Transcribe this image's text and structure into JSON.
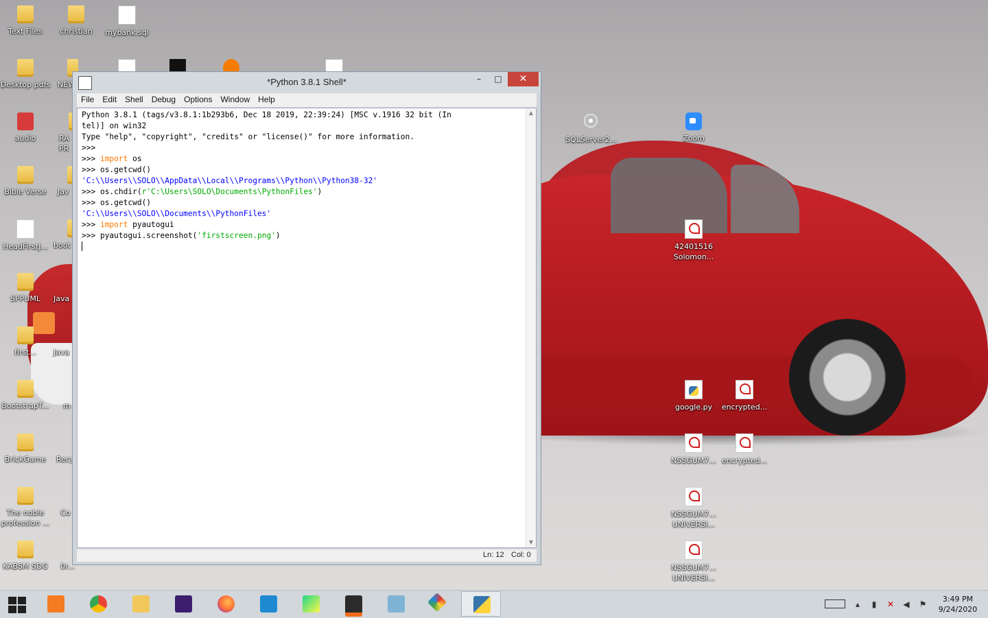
{
  "desktop": {
    "icons": [
      {
        "label": "Text Files"
      },
      {
        "label": "christian"
      },
      {
        "label": "mybank.sql"
      },
      {
        "label": "Desktop pdfs"
      },
      {
        "label": "NEW"
      },
      {
        "label": "audio"
      },
      {
        "label": "RA PR"
      },
      {
        "label": "Bible Verse"
      },
      {
        "label": "Jav"
      },
      {
        "label": "HeadFirstJ..."
      },
      {
        "label": "boot"
      },
      {
        "label": "SPPUML"
      },
      {
        "label": "Java"
      },
      {
        "label": "first..."
      },
      {
        "label": "Java"
      },
      {
        "label": "BootstrapT..."
      },
      {
        "label": "m"
      },
      {
        "label": "BrickGame"
      },
      {
        "label": "Recy"
      },
      {
        "label": "The noble profession ..."
      },
      {
        "label": "Co"
      },
      {
        "label": "KABSM SDG"
      },
      {
        "label": "0r..."
      },
      {
        "label": "SQLServer2..."
      },
      {
        "label": "Zoom"
      },
      {
        "label": "42401516 Solomon..."
      },
      {
        "label": "google.py"
      },
      {
        "label": "encrypted..."
      },
      {
        "label": "NSSGUM7..."
      },
      {
        "label": "encrypted..."
      },
      {
        "label": "NSSGUM7... UNIVERSI..."
      },
      {
        "label": "NSSGUM7... UNIVERSI..."
      }
    ]
  },
  "shell": {
    "title": "*Python 3.8.1 Shell*",
    "controls": {
      "minimize": "–",
      "maximize": "□",
      "close": "✕"
    },
    "menu": [
      "File",
      "Edit",
      "Shell",
      "Debug",
      "Options",
      "Window",
      "Help"
    ],
    "lines": [
      {
        "parts": [
          {
            "t": "Python 3.8.1 (tags/v3.8.1:1b293b6, Dec 18 2019, 22:39:24) [MSC v.1916 32 bit (In",
            "c": ""
          }
        ]
      },
      {
        "parts": [
          {
            "t": "tel)] on win32",
            "c": ""
          }
        ]
      },
      {
        "parts": [
          {
            "t": "Type \"help\", \"copyright\", \"credits\" or \"license()\" for more information.",
            "c": ""
          }
        ]
      },
      {
        "parts": [
          {
            "t": ">>> ",
            "c": ""
          }
        ]
      },
      {
        "parts": [
          {
            "t": ">>> ",
            "c": ""
          },
          {
            "t": "import",
            "c": "kw"
          },
          {
            "t": " os",
            "c": ""
          }
        ]
      },
      {
        "parts": [
          {
            "t": ">>> ",
            "c": ""
          },
          {
            "t": "os.getcwd()",
            "c": ""
          }
        ]
      },
      {
        "parts": [
          {
            "t": "'C:\\\\Users\\\\SOLO\\\\AppData\\\\Local\\\\Programs\\\\Python\\\\Python38-32'",
            "c": "out"
          }
        ]
      },
      {
        "parts": [
          {
            "t": ">>> ",
            "c": ""
          },
          {
            "t": "os.chdir(",
            "c": ""
          },
          {
            "t": "r'C:\\Users\\SOLO\\Documents\\PythonFiles'",
            "c": "str"
          },
          {
            "t": ")",
            "c": ""
          }
        ]
      },
      {
        "parts": [
          {
            "t": ">>> ",
            "c": ""
          },
          {
            "t": "os.getcwd()",
            "c": ""
          }
        ]
      },
      {
        "parts": [
          {
            "t": "'C:\\\\Users\\\\SOLO\\\\Documents\\\\PythonFiles'",
            "c": "out"
          }
        ]
      },
      {
        "parts": [
          {
            "t": ">>> ",
            "c": ""
          },
          {
            "t": "import",
            "c": "kw"
          },
          {
            "t": " pyautogui",
            "c": ""
          }
        ]
      },
      {
        "parts": [
          {
            "t": ">>> ",
            "c": ""
          },
          {
            "t": "pyautogui.screenshot(",
            "c": ""
          },
          {
            "t": "'firstscreen.png'",
            "c": "str"
          },
          {
            "t": ")",
            "c": ""
          }
        ]
      }
    ],
    "status": {
      "ln": "Ln: 12",
      "col": "Col: 0"
    }
  },
  "taskbar": {
    "apps": [
      {
        "name": "start-button",
        "icon": "windows-logo-icon",
        "color": "#1a1a1a"
      },
      {
        "name": "xampp",
        "icon": "xampp-icon",
        "color": "#f57c20"
      },
      {
        "name": "chrome",
        "icon": "chrome-icon",
        "color": "#34a853"
      },
      {
        "name": "file-explorer",
        "icon": "folder-icon",
        "color": "#f1c75b"
      },
      {
        "name": "texworks",
        "icon": "tex-icon",
        "color": "#3b1f6e"
      },
      {
        "name": "firefox",
        "icon": "firefox-icon",
        "color": "#ff7139"
      },
      {
        "name": "vscode",
        "icon": "vscode-icon",
        "color": "#1f8ad2"
      },
      {
        "name": "pycharm",
        "icon": "pycharm-icon",
        "color": "#111111"
      },
      {
        "name": "sublime",
        "icon": "sublime-icon",
        "color": "#ef6c1a"
      },
      {
        "name": "notepad",
        "icon": "notepad-icon",
        "color": "#7fb3d5"
      },
      {
        "name": "app-colorful",
        "icon": "colorful-app-icon",
        "color": "#e53935"
      },
      {
        "name": "python-idle",
        "icon": "python-idle-icon",
        "color": "#3776ab"
      }
    ],
    "time": "3:49 PM",
    "date": "9/24/2020"
  }
}
